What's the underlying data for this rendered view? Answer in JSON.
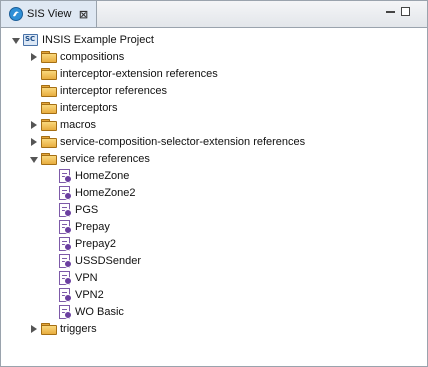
{
  "view": {
    "tab_title": "SIS View",
    "tab_icon": "sis-icon",
    "close_glyph": "⊠"
  },
  "tree": {
    "root": {
      "label": "INSIS Example Project",
      "icon": "project-icon",
      "expanded": true
    },
    "folders": [
      {
        "label": "compositions",
        "expanded": false,
        "has_children": true
      },
      {
        "label": "interceptor-extension references",
        "expanded": false,
        "has_children": false
      },
      {
        "label": "interceptor references",
        "expanded": false,
        "has_children": false
      },
      {
        "label": "interceptors",
        "expanded": false,
        "has_children": false
      },
      {
        "label": "macros",
        "expanded": false,
        "has_children": true
      },
      {
        "label": "service-composition-selector-extension references",
        "expanded": false,
        "has_children": true
      },
      {
        "label": "service references",
        "expanded": true,
        "has_children": true
      },
      {
        "label": "triggers",
        "expanded": false,
        "has_children": true
      }
    ],
    "service_references": [
      "HomeZone",
      "HomeZone2",
      "PGS",
      "Prepay",
      "Prepay2",
      "USSDSender",
      "VPN",
      "VPN2",
      "WO Basic"
    ]
  },
  "colors": {
    "folder": "#e8ad3f",
    "service_ref": "#6b3fa0",
    "tab_active": "#dfe8f3"
  }
}
